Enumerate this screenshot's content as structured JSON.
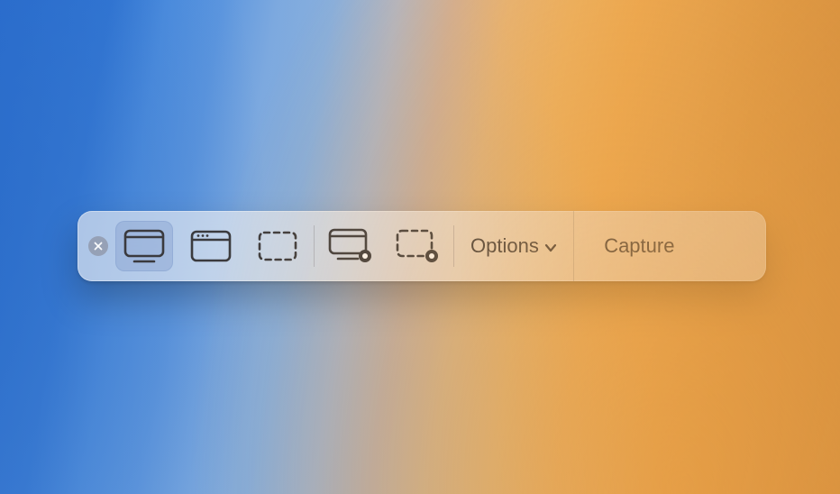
{
  "toolbar": {
    "close_icon": "close",
    "options_label": "Options",
    "capture_label": "Capture",
    "tools": {
      "capture_screen": {
        "name": "capture-entire-screen",
        "selected": true
      },
      "capture_window": {
        "name": "capture-selected-window",
        "selected": false
      },
      "capture_selection": {
        "name": "capture-selected-portion",
        "selected": false
      },
      "record_screen": {
        "name": "record-entire-screen",
        "selected": false
      },
      "record_selection": {
        "name": "record-selected-portion",
        "selected": false
      }
    }
  }
}
